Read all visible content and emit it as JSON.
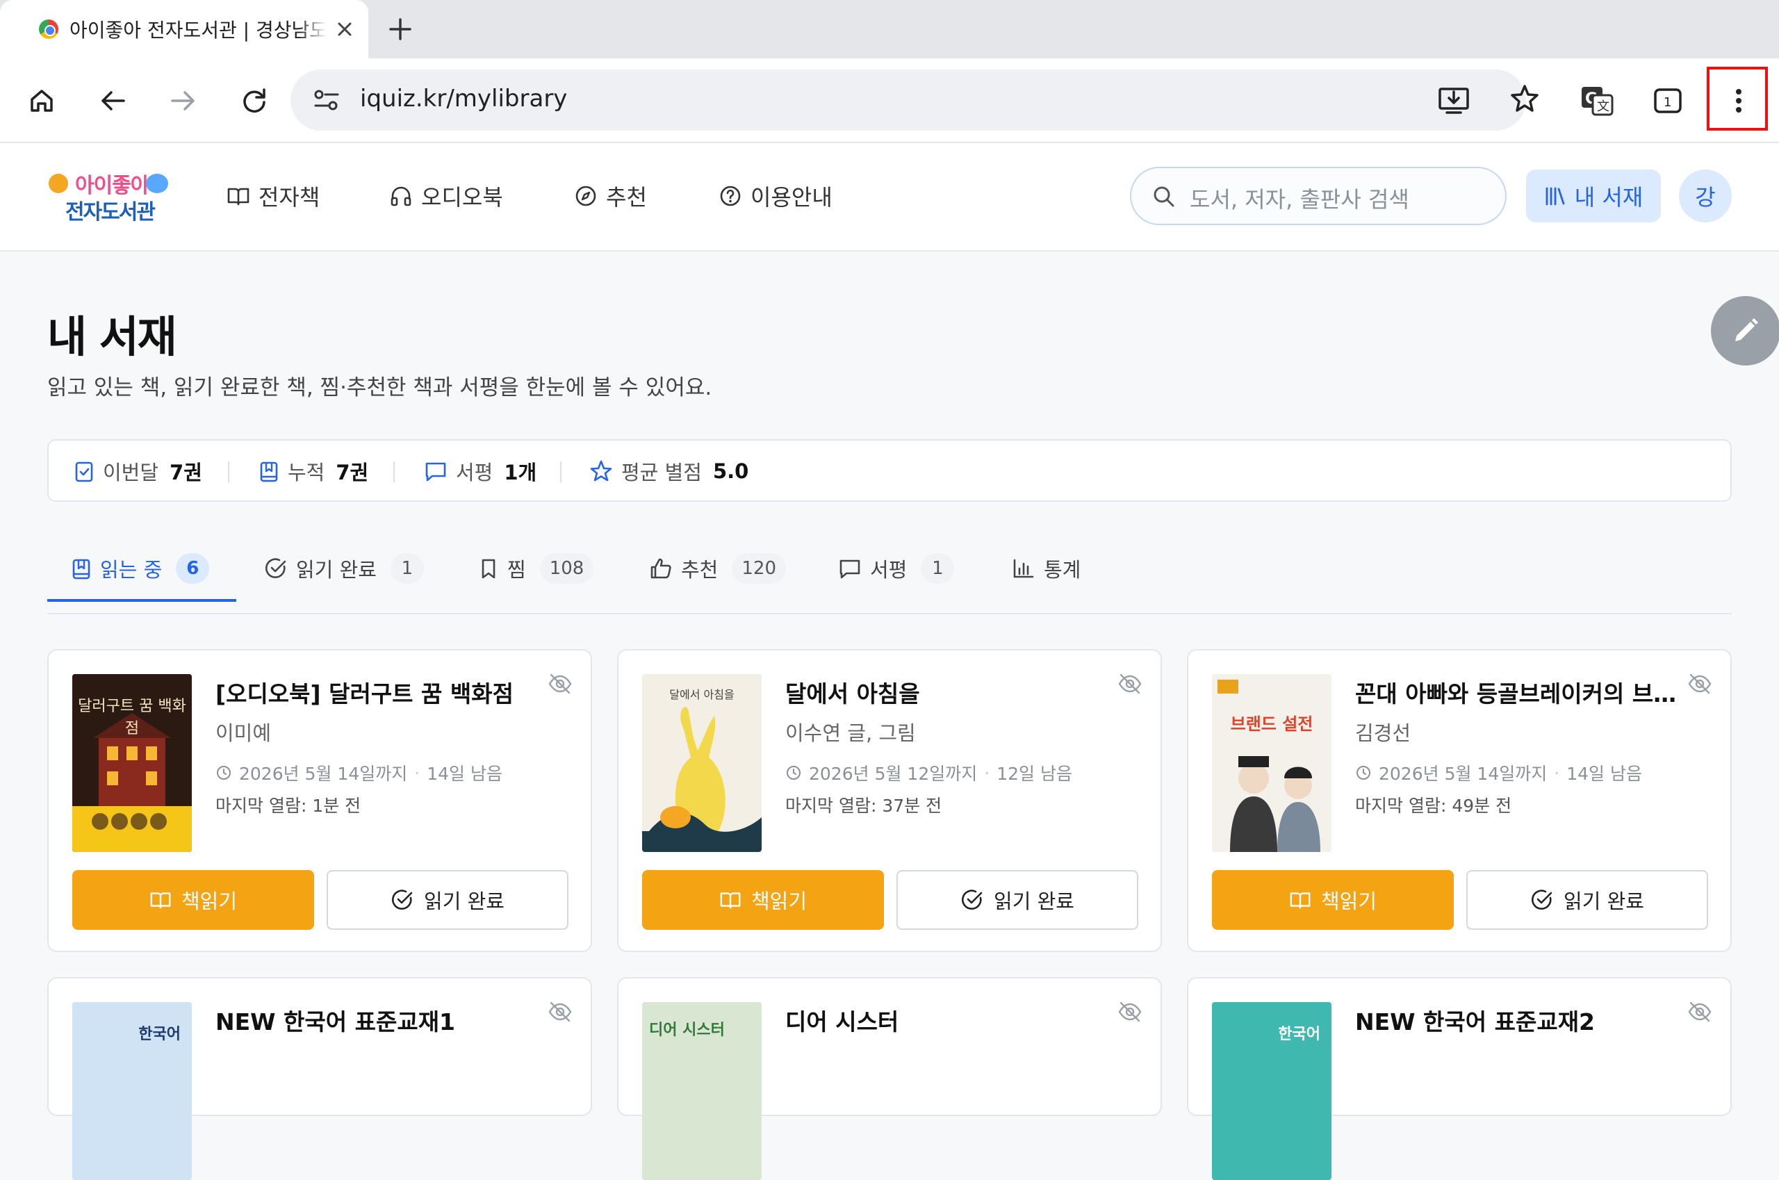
{
  "browser": {
    "tab_title": "아이좋아 전자도서관 | 경상남도교육청",
    "url": "iquiz.kr/mylibrary",
    "tab_count": "1"
  },
  "site": {
    "logo_line1": "아이좋아",
    "logo_line2": "전자도서관",
    "nav": [
      {
        "label": "전자책",
        "icon": "book-open-icon"
      },
      {
        "label": "오디오북",
        "icon": "headphones-icon"
      },
      {
        "label": "추천",
        "icon": "compass-icon"
      },
      {
        "label": "이용안내",
        "icon": "help-circle-icon"
      }
    ],
    "search_placeholder": "도서, 저자, 출판사 검색",
    "my_shelf_label": "내 서재",
    "avatar_initial": "강"
  },
  "page": {
    "title": "내 서재",
    "subtitle": "읽고 있는 책, 읽기 완료한 책, 찜·추천한 책과 서평을 한눈에 볼 수 있어요."
  },
  "stats": [
    {
      "label": "이번달",
      "value": "7권",
      "icon": "calendar-check-icon"
    },
    {
      "label": "누적",
      "value": "7권",
      "icon": "bookmark-book-icon"
    },
    {
      "label": "서평",
      "value": "1개",
      "icon": "message-icon"
    },
    {
      "label": "평균 별점",
      "value": "5.0",
      "icon": "star-icon"
    }
  ],
  "tabs": [
    {
      "label": "읽는 중",
      "count": "6",
      "active": true
    },
    {
      "label": "읽기 완료",
      "count": "1"
    },
    {
      "label": "찜",
      "count": "108"
    },
    {
      "label": "추천",
      "count": "120"
    },
    {
      "label": "서평",
      "count": "1"
    },
    {
      "label": "통계",
      "count": ""
    }
  ],
  "books": [
    {
      "title": "[오디오북] 달러구트 꿈 백화점",
      "author": "이미예",
      "due": "2026년 5월 14일까지",
      "remaining": "14일 남음",
      "last_read": "마지막 열람: 1분 전",
      "read_label": "책읽기",
      "done_label": "읽기 완료",
      "cover_text": "달러구트 꿈 백화점",
      "cover_bg": "#2b1a12",
      "cover_accent": "#f5c518"
    },
    {
      "title": "달에서 아침을",
      "author": "이수연 글, 그림",
      "due": "2026년 5월 12일까지",
      "remaining": "12일 남음",
      "last_read": "마지막 열람: 37분 전",
      "read_label": "책읽기",
      "done_label": "읽기 완료",
      "cover_text": "달에서 아침을",
      "cover_bg": "#f3efe4",
      "cover_accent": "#f2d84a"
    },
    {
      "title": "꼰대 아빠와 등골브레이커의 브랜드 설전",
      "author": "김경선",
      "due": "2026년 5월 14일까지",
      "remaining": "14일 남음",
      "last_read": "마지막 열람: 49분 전",
      "read_label": "책읽기",
      "done_label": "읽기 완료",
      "cover_text": "브랜드 설전",
      "cover_bg": "#f4f1ea",
      "cover_accent": "#d9442b"
    },
    {
      "title": "NEW 한국어 표준교재1",
      "cover_text": "한국어",
      "cover_bg": "#cfe3f5"
    },
    {
      "title": "디어 시스터",
      "cover_text": "디어 시스터",
      "cover_bg": "#d8e6d2"
    },
    {
      "title": "NEW 한국어 표준교재2",
      "cover_text": "한국어",
      "cover_bg": "#3fb8b0"
    }
  ],
  "colors": {
    "accent_blue": "#2563eb",
    "read_button": "#f4a312",
    "highlight_box": "#ee1111"
  }
}
